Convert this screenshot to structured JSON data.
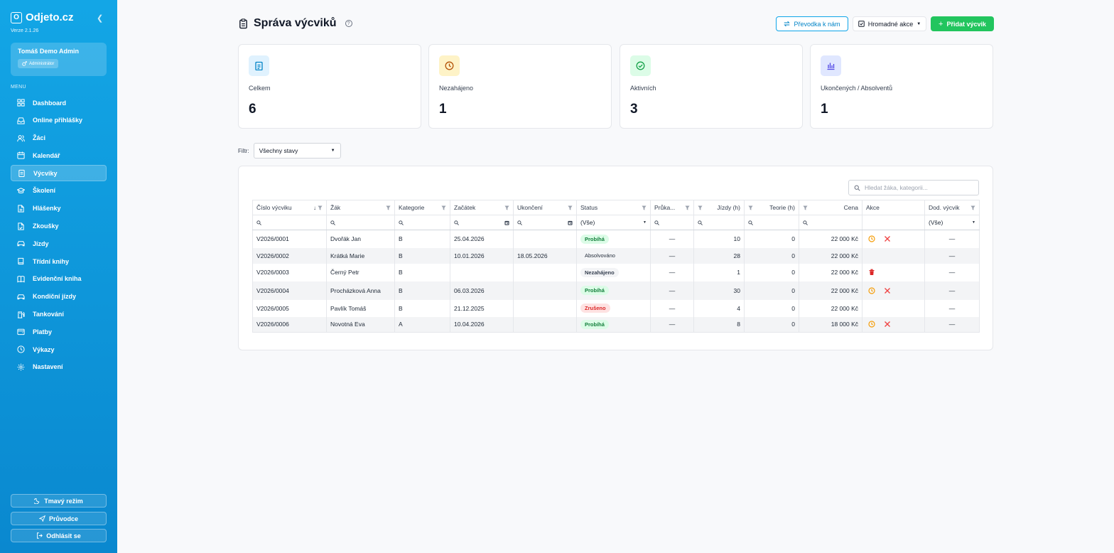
{
  "sidebar": {
    "logo_letter": "O",
    "app_name": "Odjeto.cz",
    "version": "Verze 2.1.26",
    "user_name": "Tomáš Demo Admin",
    "role": "Administrátor",
    "menu_label": "MENU",
    "items": [
      {
        "label": "Dashboard",
        "icon": "grid-icon"
      },
      {
        "label": "Online přihlášky",
        "icon": "inbox-icon"
      },
      {
        "label": "Žáci",
        "icon": "users-icon"
      },
      {
        "label": "Kalendář",
        "icon": "calendar-icon"
      },
      {
        "label": "Výcviky",
        "icon": "clipboard-icon"
      },
      {
        "label": "Školení",
        "icon": "graduation-cap-icon"
      },
      {
        "label": "Hlášenky",
        "icon": "document-icon"
      },
      {
        "label": "Zkoušky",
        "icon": "document-check-icon"
      },
      {
        "label": "Jízdy",
        "icon": "car-icon"
      },
      {
        "label": "Třídní knihy",
        "icon": "book-icon"
      },
      {
        "label": "Evidenční kniha",
        "icon": "book-open-icon"
      },
      {
        "label": "Kondiční jízdy",
        "icon": "car-icon"
      },
      {
        "label": "Tankování",
        "icon": "fuel-icon"
      },
      {
        "label": "Platby",
        "icon": "wallet-icon"
      },
      {
        "label": "Výkazy",
        "icon": "clock-icon"
      },
      {
        "label": "Nastavení",
        "icon": "gear-icon"
      }
    ],
    "active_index": 4,
    "dark_mode": "Tmavý režim",
    "guide": "Průvodce",
    "logout": "Odhlásit se"
  },
  "header": {
    "title": "Správa výcviků",
    "transfer_button": "Převodka k nám",
    "bulk_button": "Hromadné akce",
    "add_button": "Přidat výcvik"
  },
  "stats": [
    {
      "label": "Celkem",
      "value": "6",
      "icon": "clipboard-icon",
      "bg": "#e0f2fe",
      "fg": "#0284c7"
    },
    {
      "label": "Nezahájeno",
      "value": "1",
      "icon": "clock-icon",
      "bg": "#fef3c7",
      "fg": "#b45309"
    },
    {
      "label": "Aktivních",
      "value": "3",
      "icon": "check-circle-icon",
      "bg": "#dcfce7",
      "fg": "#16a34a"
    },
    {
      "label": "Ukončených / Absolventů",
      "value": "1",
      "icon": "bar-chart-icon",
      "bg": "#e0e7ff",
      "fg": "#4f46e5"
    }
  ],
  "filter": {
    "label": "Filtr:",
    "value": "Všechny stavy"
  },
  "table": {
    "search_placeholder": "Hledat žáka, kategorii...",
    "columns": [
      "Číslo výcviku",
      "Žák",
      "Kategorie",
      "Začátek",
      "Ukončení",
      "Status",
      "Průka...",
      "Jízdy (h)",
      "Teorie (h)",
      "Cena",
      "Akce",
      "Dod. výcvik"
    ],
    "status_filter": "(Vše)",
    "dod_filter": "(Vše)",
    "dash": "—",
    "rows": [
      {
        "cislo": "V2026/0001",
        "zak": "Dvořák Jan",
        "kat": "B",
        "zacatek": "25.04.2026",
        "ukonceni": "",
        "status": "Probíhá",
        "tone": "green",
        "jizdy": "10",
        "teorie": "0",
        "cena": "22 000 Kč",
        "actions": [
          "clock",
          "x"
        ]
      },
      {
        "cislo": "V2026/0002",
        "zak": "Krátká Marie",
        "kat": "B",
        "zacatek": "10.01.2026",
        "ukonceni": "18.05.2026",
        "status": "Absolvováno",
        "tone": "plain",
        "jizdy": "28",
        "teorie": "0",
        "cena": "22 000 Kč",
        "actions": []
      },
      {
        "cislo": "V2026/0003",
        "zak": "Černý Petr",
        "kat": "B",
        "zacatek": "",
        "ukonceni": "",
        "status": "Nezahájeno",
        "tone": "gray",
        "jizdy": "1",
        "teorie": "0",
        "cena": "22 000 Kč",
        "actions": [
          "trash"
        ]
      },
      {
        "cislo": "V2026/0004",
        "zak": "Procházková Anna",
        "kat": "B",
        "zacatek": "06.03.2026",
        "ukonceni": "",
        "status": "Probíhá",
        "tone": "green",
        "jizdy": "30",
        "teorie": "0",
        "cena": "22 000 Kč",
        "actions": [
          "clock",
          "x"
        ]
      },
      {
        "cislo": "V2026/0005",
        "zak": "Pavlík Tomáš",
        "kat": "B",
        "zacatek": "21.12.2025",
        "ukonceni": "",
        "status": "Zrušeno",
        "tone": "red",
        "jizdy": "4",
        "teorie": "0",
        "cena": "22 000 Kč",
        "actions": []
      },
      {
        "cislo": "V2026/0006",
        "zak": "Novotná Eva",
        "kat": "A",
        "zacatek": "10.04.2026",
        "ukonceni": "",
        "status": "Probíhá",
        "tone": "green",
        "jizdy": "8",
        "teorie": "0",
        "cena": "18 000 Kč",
        "actions": [
          "clock",
          "x"
        ]
      }
    ]
  },
  "colors": {
    "sidebar": "#0ea5e9",
    "accent": "#0284c7",
    "success": "#22c55e",
    "danger": "#dc2626",
    "warning": "#f59e0b"
  }
}
